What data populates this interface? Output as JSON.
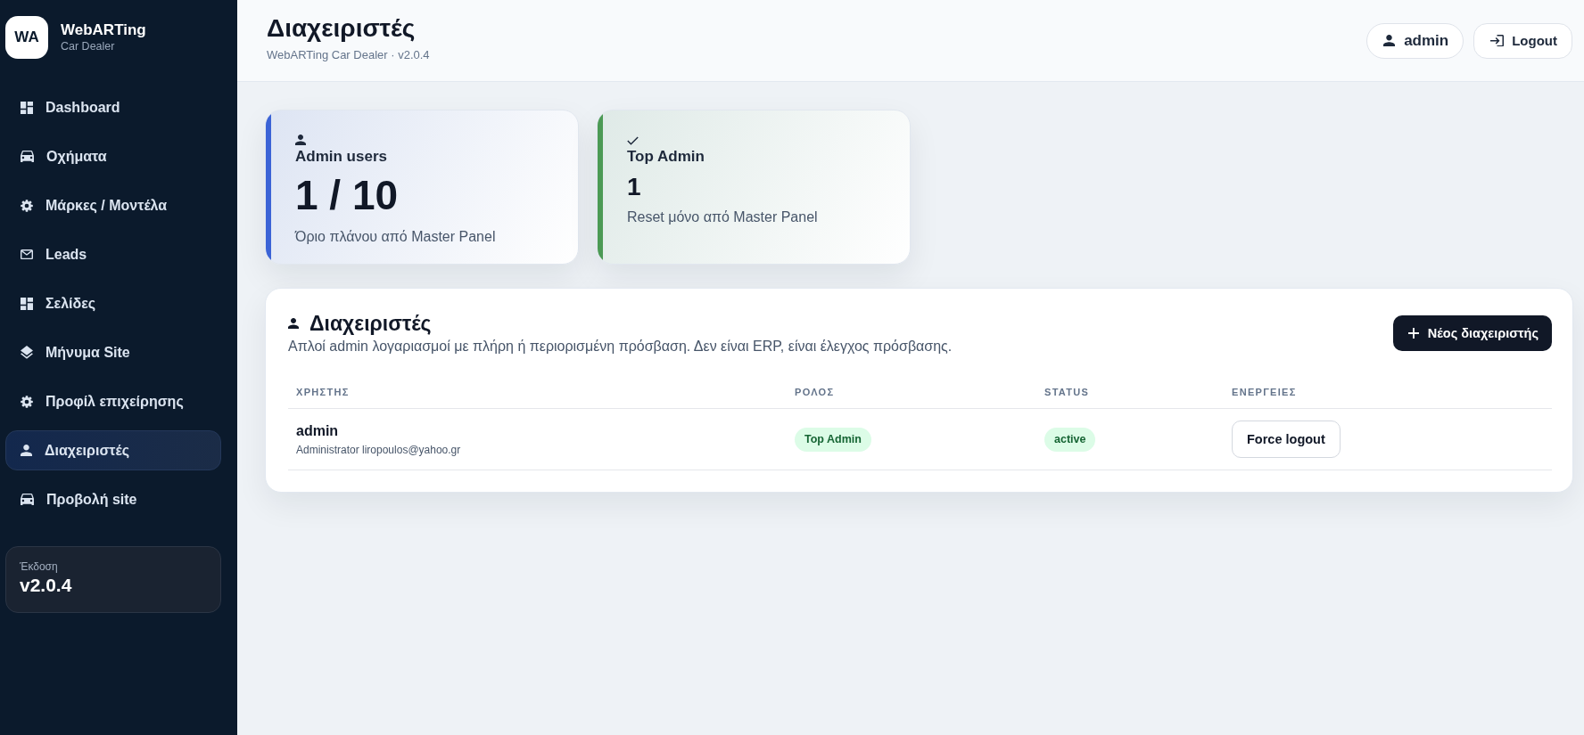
{
  "sidebar": {
    "logo": "WA",
    "brand": "WebARTing",
    "tagline": "Car Dealer",
    "items": [
      {
        "label": "Dashboard",
        "selected": false
      },
      {
        "label": "Οχήματα",
        "selected": false
      },
      {
        "label": "Μάρκες / Μοντέλα",
        "selected": false
      },
      {
        "label": "Leads",
        "selected": false
      },
      {
        "label": "Σελίδες",
        "selected": false
      },
      {
        "label": "Μήνυμα Site",
        "selected": false
      },
      {
        "label": "Προφίλ επιχείρησης",
        "selected": false
      },
      {
        "label": "Διαχειριστές",
        "selected": true
      },
      {
        "label": "Προβολή site",
        "selected": false
      }
    ],
    "version": {
      "label": "Έκδοση",
      "value": "v2.0.4"
    }
  },
  "header": {
    "title": "Διαχειριστές",
    "subtitle": "WebARTing Car Dealer · v2.0.4",
    "user": "admin",
    "logout": "Logout"
  },
  "stats": [
    {
      "kind": "large",
      "title": "Admin users",
      "value": "1 / 10",
      "note": "Όριο πλάνου από Master Panel",
      "color": "#3b63d6"
    },
    {
      "kind": "compact",
      "title": "Top Admin",
      "value": "1",
      "note": "Reset μόνο από Master Panel",
      "color": "#4c9a55"
    }
  ],
  "panel": {
    "title": "Διαχειριστές",
    "description": "Απλοί admin λογαριασμοί με πλήρη ή περιορισμένη πρόσβαση. Δεν είναι ERP, είναι έλεγχος πρόσβασης.",
    "new_button": "Νέος διαχειριστής",
    "table": {
      "columns": [
        "ΧΡΗΣΤΗΣ",
        "ΡΟΛΟΣ",
        "STATUS",
        "ΕΝΕΡΓΕΙΕΣ"
      ],
      "rows": [
        {
          "name": "admin",
          "details": "Administrator liropoulos@yahoo.gr",
          "role": "Top Admin",
          "status": "active",
          "action": "Force logout"
        }
      ]
    }
  }
}
